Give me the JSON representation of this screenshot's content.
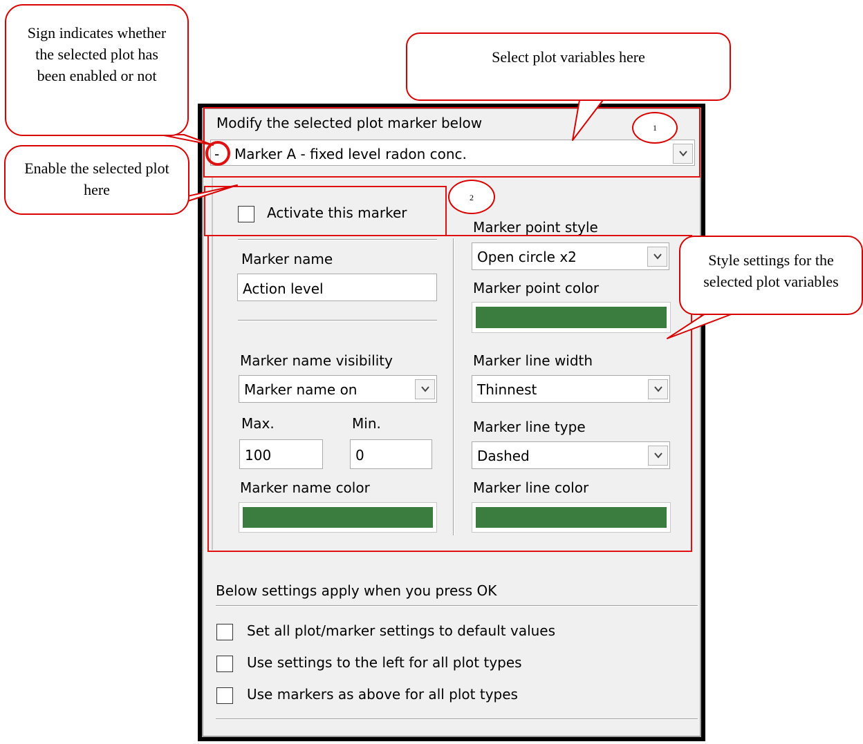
{
  "dialog": {
    "marker_selector": {
      "heading": "Modify the selected plot marker below",
      "sign": "-",
      "selected": "Marker A - fixed level radon conc."
    },
    "activate_label": "Activate this marker",
    "marker_name": {
      "label": "Marker name",
      "value": "Action level"
    },
    "name_visibility": {
      "label": "Marker name visibility",
      "selected": "Marker name on"
    },
    "max": {
      "label": "Max.",
      "value": "100"
    },
    "min": {
      "label": "Min.",
      "value": "0"
    },
    "name_color": {
      "label": "Marker name color",
      "color": "#3a7d3e"
    },
    "point_style": {
      "label": "Marker point style",
      "selected": "Open circle x2"
    },
    "point_color": {
      "label": "Marker point color",
      "color": "#3a7d3e"
    },
    "line_width": {
      "label": "Marker line width",
      "selected": "Thinnest"
    },
    "line_type": {
      "label": "Marker line type",
      "selected": "Dashed"
    },
    "line_color": {
      "label": "Marker line color",
      "color": "#3a7d3e"
    },
    "apply_heading": "Below settings apply when you press OK",
    "options": [
      "Set all plot/marker settings to default values",
      "Use settings to the left for all plot types",
      "Use markers as above for all plot types"
    ]
  },
  "callouts": {
    "sign": "Sign indicates whether the selected plot has been enabled or not",
    "enable": "Enable the selected plot here",
    "select": "Select plot variables here",
    "style": "Style settings for the selected plot variables",
    "num1": "1",
    "num2": "2"
  },
  "colors": {
    "annotation": "#d90000",
    "swatch_green": "#3a7d3e"
  },
  "icons": {
    "dropdown": "chevron-down-icon",
    "checkbox": "checkbox-icon"
  }
}
